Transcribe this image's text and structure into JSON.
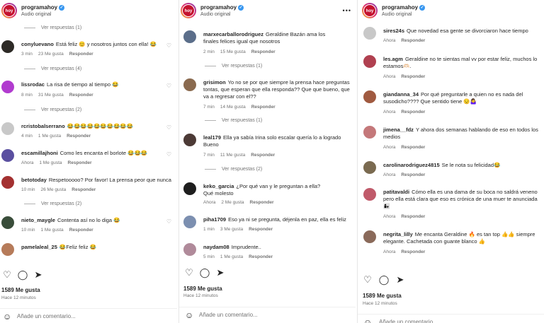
{
  "header": {
    "username": "programahoy",
    "audio": "Audio original",
    "avatar_text": "hoy",
    "more": "•••",
    "verified": "✓"
  },
  "ui": {
    "view_replies_1": "Ver respuestas (1)",
    "view_replies_2": "Ver respuestas (2)",
    "view_replies_4": "Ver respuestas (4)",
    "reply": "Responder",
    "likes": "1589 Me gusta",
    "time_ago": "Hace 12 minutos",
    "add_comment": "Añade un comentario...",
    "heart": "♡",
    "like_icon": "♡",
    "comment_icon": "◯",
    "share_icon": "➤",
    "smile_icon": "☺"
  },
  "panel0": {
    "comments": [
      {
        "user": "conyluevano",
        "text": "Está feliz 😊 y nosotros juntos con ella! 😂",
        "time": "3 min",
        "likes": "23 Me gusta",
        "avatar": "#2d2a26"
      },
      {
        "user": "lissrodac",
        "text": "La risa de tiempo al tiempo 😂",
        "time": "8 min",
        "likes": "31 Me gusta",
        "avatar": "#b13bcf"
      },
      {
        "user": "rcristobalserrano",
        "text": "😂😂😂😂😂😂😂😂😂😂",
        "time": "4 min",
        "likes": "1 Me gusta",
        "avatar": "#c8c8c8"
      },
      {
        "user": "escamillajhoni",
        "text": "Como les encanta el borlote 😂😂😂",
        "time": "Ahora",
        "likes": "1 Me gusta",
        "avatar": "#5a4fa0"
      },
      {
        "user": "betotoday",
        "text": "Respetooooo? Por favor! La prensa peor que nunca",
        "time": "10 min",
        "likes": "26 Me gusta",
        "avatar": "#a33030"
      },
      {
        "user": "nieto_maygle",
        "text": "Contenta así no lo diga 😂",
        "time": "10 min",
        "likes": "1 Me gusta",
        "avatar": "#394d3a"
      },
      {
        "user": "pamelaleal_25",
        "text": "😂Feliz feliz 😂",
        "time": "",
        "likes": "",
        "avatar": "#b67b5a"
      }
    ]
  },
  "panel1": {
    "comments": [
      {
        "user": "marxecarballorodriguez",
        "text": "Geraldine Bazán ama los finales felices igual que nosotros",
        "time": "2 min",
        "likes": "15 Me gusta",
        "avatar": "#5b6e8a"
      },
      {
        "user": "grisimon",
        "text": "Yo no se por que siempre la prensa hace preguntas tontas, que esperan que ella responda?? Que que bueno, que va a regresar con el??",
        "time": "7 min",
        "likes": "14 Me gusta",
        "avatar": "#8a6a4f"
      },
      {
        "user": "leal179",
        "text": "Ella ya sabía Irina solo escalar quería lo a logrado Bueno",
        "time": "7 min",
        "likes": "11 Me gusta",
        "avatar": "#4c3a36"
      },
      {
        "user": "keko_garcia",
        "text": "¿Por qué van y le preguntan a ella? Qué molesto",
        "time": "Ahora",
        "likes": "2 Me gusta",
        "avatar": "#1e1e1e"
      },
      {
        "user": "piha1709",
        "text": "Eso ya ni se pregunta, déjenla en paz, ella es feliz",
        "time": "1 min",
        "likes": "3 Me gusta",
        "avatar": "#7c8fb0"
      },
      {
        "user": "naydam08",
        "text": "Imprudente..",
        "time": "5 min",
        "likes": "1 Me gusta",
        "avatar": "#b08a9a"
      }
    ]
  },
  "panel2": {
    "comments": [
      {
        "user": "sires24s",
        "text": "Que novedad esa gente se divorciaron hace tiempo",
        "time": "Ahora",
        "likes": "",
        "avatar": "#c8c8c8"
      },
      {
        "user": "les.agm",
        "text": "Geraldine no te sientas mal vv por estar feliz, muchos lo estamos🫶🏻.",
        "time": "Ahora",
        "likes": "",
        "avatar": "#b04050"
      },
      {
        "user": "giandanna_34",
        "text": "Por qué preguntarle a quien no es nada del susodicho???? Que sentido tiene 😒🤷‍♀️",
        "time": "Ahora",
        "likes": "",
        "avatar": "#a05a40"
      },
      {
        "user": "jimena__fdz",
        "text": "Y ahora dos semanas hablando de eso en todos los medios",
        "time": "Ahora",
        "likes": "",
        "avatar": "#c4787a"
      },
      {
        "user": "carolinarodriguez4815",
        "text": "Se le nota su felicidad😂",
        "time": "Ahora",
        "likes": "",
        "avatar": "#7a6a50"
      },
      {
        "user": "patitavaldi",
        "text": "Cómo ella es una dama de su boca no saldrá veneno pero ella está clara que eso es crónica de una muer te anunciada 👩‍👧",
        "time": "Ahora",
        "likes": "",
        "avatar": "#c05a6a"
      },
      {
        "user": "negrita_lilly",
        "text": "Me encanta Geraldine 🔥 es tan top 👍👍 siempre elegante. Cachetada con guante blanco 👍",
        "time": "Ahora",
        "likes": "",
        "avatar": "#8a6a5a"
      }
    ]
  }
}
